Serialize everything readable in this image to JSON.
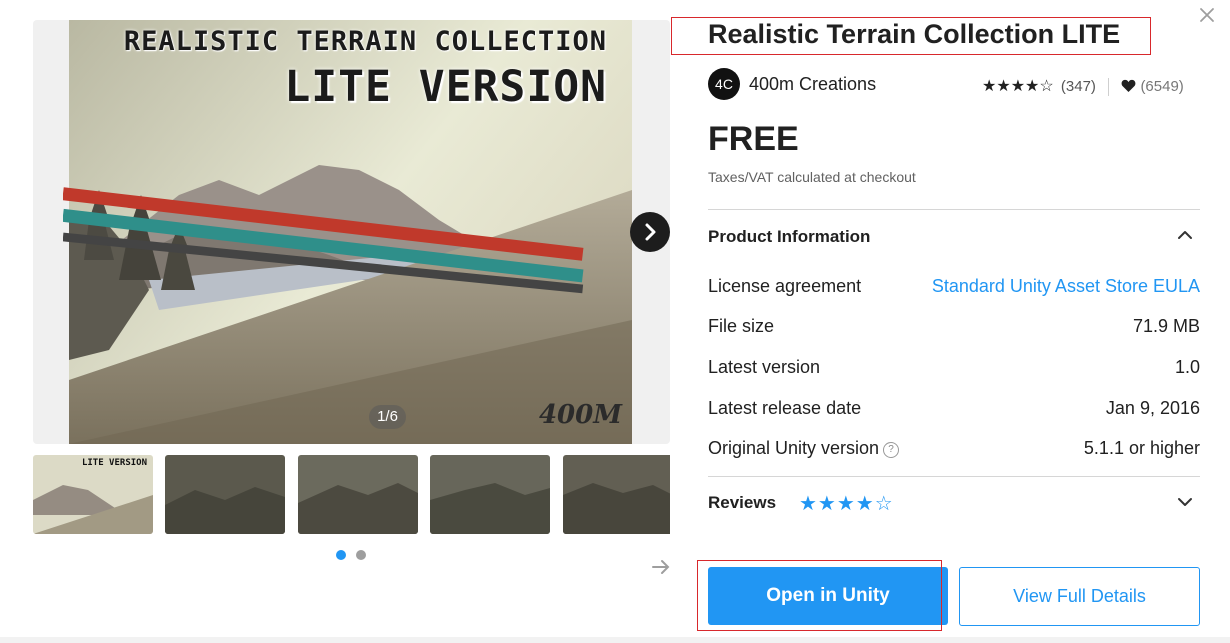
{
  "gallery": {
    "image_title_line1": "REALISTIC TERRAIN COLLECTION",
    "image_title_line2": "LITE VERSION",
    "image_logo": "400M",
    "slide_counter": "1/6",
    "thumb1_label": "LITE VERSION",
    "thumbnail_count": 5,
    "dots": {
      "active_color": "#2196f3",
      "inactive_color": "#9e9e9e"
    }
  },
  "product": {
    "title": "Realistic Terrain Collection LITE",
    "publisher_avatar": "4C",
    "publisher": "400m Creations",
    "rating_stars": "★★★★☆",
    "rating_count": "(347)",
    "favorites_count": "(6549)",
    "price": "FREE",
    "tax_note": "Taxes/VAT calculated at checkout"
  },
  "info": {
    "heading": "Product Information",
    "rows": [
      {
        "label": "License agreement",
        "value": "Standard Unity Asset Store EULA"
      },
      {
        "label": "File size",
        "value": "71.9 MB"
      },
      {
        "label": "Latest version",
        "value": "1.0"
      },
      {
        "label": "Latest release date",
        "value": "Jan 9, 2016"
      },
      {
        "label": "Original Unity version",
        "value": "5.1.1 or higher"
      }
    ]
  },
  "reviews": {
    "heading": "Reviews",
    "stars": "★★★★☆"
  },
  "actions": {
    "open_label": "Open in Unity",
    "details_label": "View Full Details"
  },
  "colors": {
    "accent": "#2196f3",
    "highlight_box": "#d8282c"
  },
  "icons": [
    "close-icon",
    "chevron-right-icon",
    "chevron-up-icon",
    "chevron-down-icon",
    "heart-icon",
    "help-icon",
    "arrow-right-icon"
  ]
}
